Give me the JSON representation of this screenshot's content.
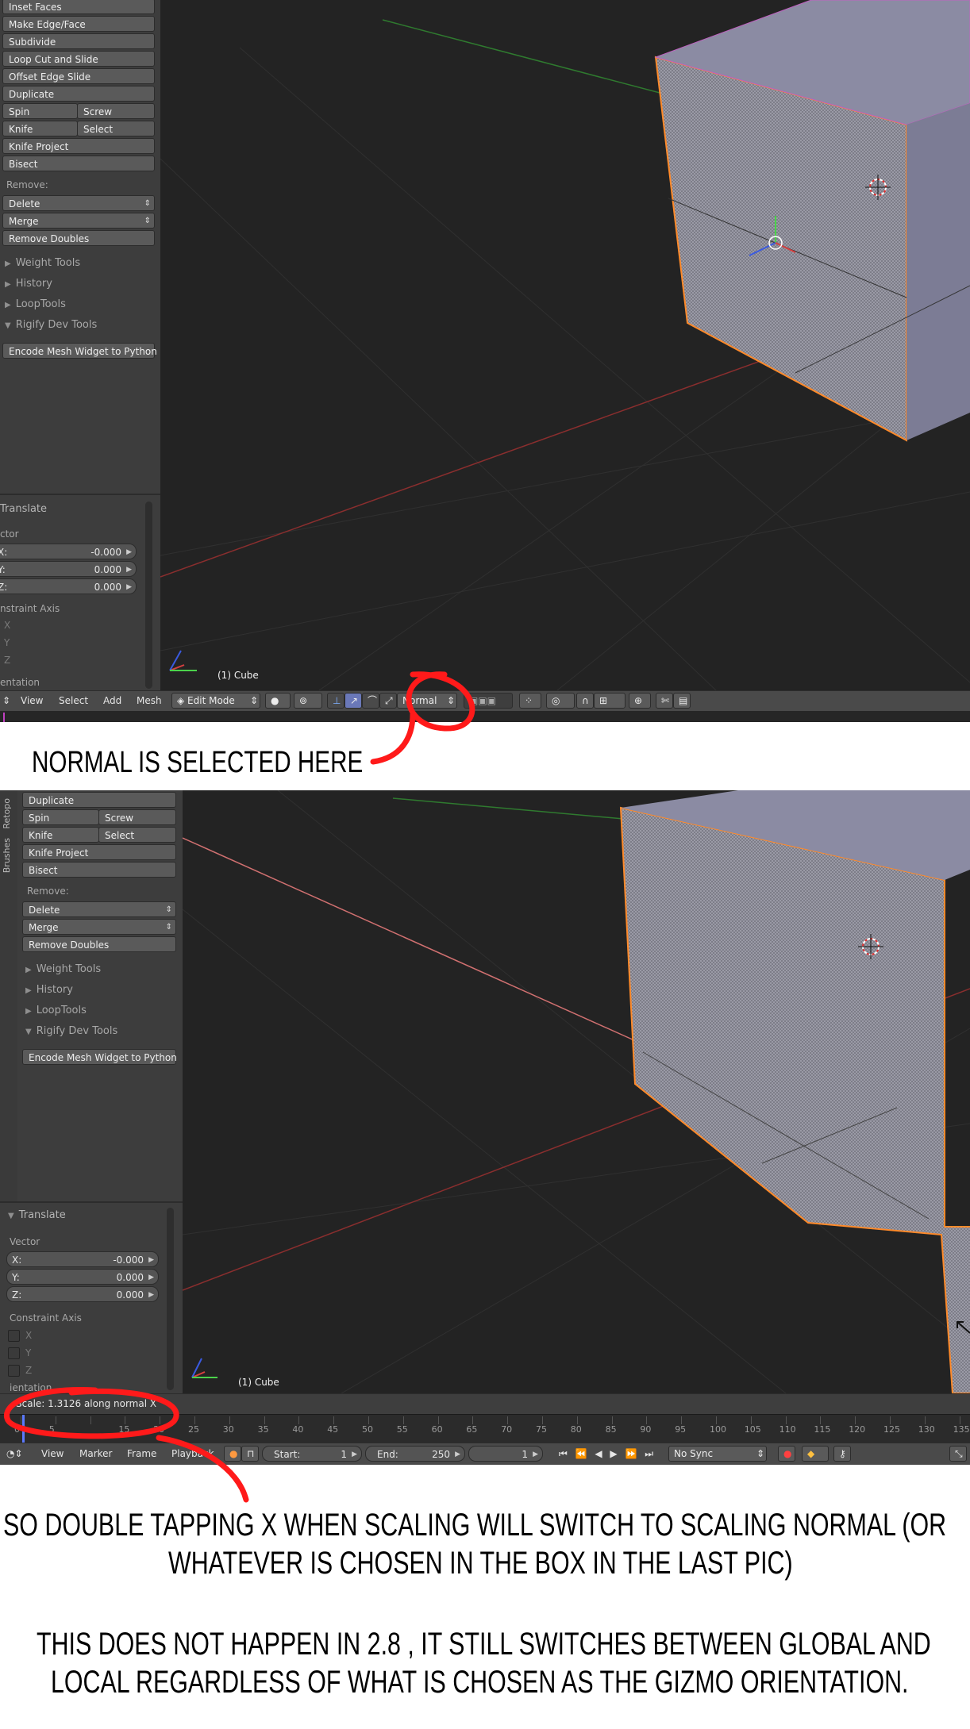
{
  "shot1": {
    "tool_buttons": [
      "Inset Faces",
      "Make Edge/Face",
      "Subdivide",
      "Loop Cut and Slide",
      "Offset Edge Slide",
      "Duplicate"
    ],
    "pairs": [
      [
        "Spin",
        "Screw"
      ],
      [
        "Knife",
        "Select"
      ]
    ],
    "tool_buttons_2": [
      "Knife Project",
      "Bisect"
    ],
    "remove_label": "Remove:",
    "remove_dropdowns": [
      "Delete",
      "Merge"
    ],
    "remove_doubles": "Remove Doubles",
    "panels": [
      "Weight Tools",
      "History",
      "LoopTools",
      "Rigify Dev Tools"
    ],
    "encode_button": "Encode Mesh Widget to Python",
    "operator_title": "Translate",
    "vector_label": "ctor",
    "vector": [
      {
        "axis": "X:",
        "value": "-0.000"
      },
      {
        "axis": "Y:",
        "value": "0.000"
      },
      {
        "axis": "Z:",
        "value": "0.000"
      }
    ],
    "constraint_label": "nstraint Axis",
    "constraint_axes": [
      "X",
      "Y",
      "Z"
    ],
    "orientation_label": "entation",
    "object_name": "(1) Cube",
    "header": {
      "menus": [
        "View",
        "Select",
        "Add",
        "Mesh"
      ],
      "mode": "Edit Mode",
      "orientation": "Normal"
    }
  },
  "caption1": "NORMAL IS SELECTED HERE",
  "shot2": {
    "side_tabs": [
      "Retopo",
      "Brushes"
    ],
    "tool_buttons": [
      "Duplicate"
    ],
    "pairs": [
      [
        "Spin",
        "Screw"
      ],
      [
        "Knife",
        "Select"
      ]
    ],
    "tool_buttons_2": [
      "Knife Project",
      "Bisect"
    ],
    "remove_label": "Remove:",
    "remove_dropdowns": [
      "Delete",
      "Merge"
    ],
    "remove_doubles": "Remove Doubles",
    "panels": [
      "Weight Tools",
      "History",
      "LoopTools",
      "Rigify Dev Tools"
    ],
    "encode_button": "Encode Mesh Widget to Python",
    "operator_title": "Translate",
    "vector_label": "Vector",
    "vector": [
      {
        "axis": "X:",
        "value": "-0.000"
      },
      {
        "axis": "Y:",
        "value": "0.000"
      },
      {
        "axis": "Z:",
        "value": "0.000"
      }
    ],
    "constraint_label": "Constraint Axis",
    "constraint_axes": [
      "X",
      "Y",
      "Z"
    ],
    "orientation_label": "ientation",
    "object_name": "(1) Cube",
    "status_text": "Scale: 1.3126 along normal X",
    "ruler": [
      "0",
      "5",
      "",
      "15",
      "20",
      "25",
      "30",
      "35",
      "40",
      "45",
      "50",
      "55",
      "60",
      "65",
      "70",
      "75",
      "80",
      "85",
      "90",
      "95",
      "100",
      "105",
      "110",
      "115",
      "120",
      "125",
      "130",
      "135"
    ],
    "timeline": {
      "menus": [
        "View",
        "Marker",
        "Frame",
        "Playback"
      ],
      "start_label": "Start:",
      "start_value": "1",
      "end_label": "End:",
      "end_value": "250",
      "current": "1",
      "sync": "No Sync"
    }
  },
  "caption2_line1": "SO DOUBLE TAPPING X WHEN SCALING WILL SWITCH TO SCALING NORMAL (OR",
  "caption2_line2": "WHATEVER IS CHOSEN IN THE BOX IN THE LAST PIC)",
  "caption3_line1": "THIS DOES NOT HAPPEN IN 2.8 , IT STILL SWITCHES BETWEEN GLOBAL AND",
  "caption3_line2": "LOCAL REGARDLESS OF WHAT IS CHOSEN AS THE GIZMO ORIENTATION.",
  "colors": {
    "selection_edge": "#ff8a2a",
    "face": "#8c8ca6",
    "annotation": "#ff1a1a",
    "x_axis": "#cc3333",
    "y_axis": "#3d9a3d"
  }
}
